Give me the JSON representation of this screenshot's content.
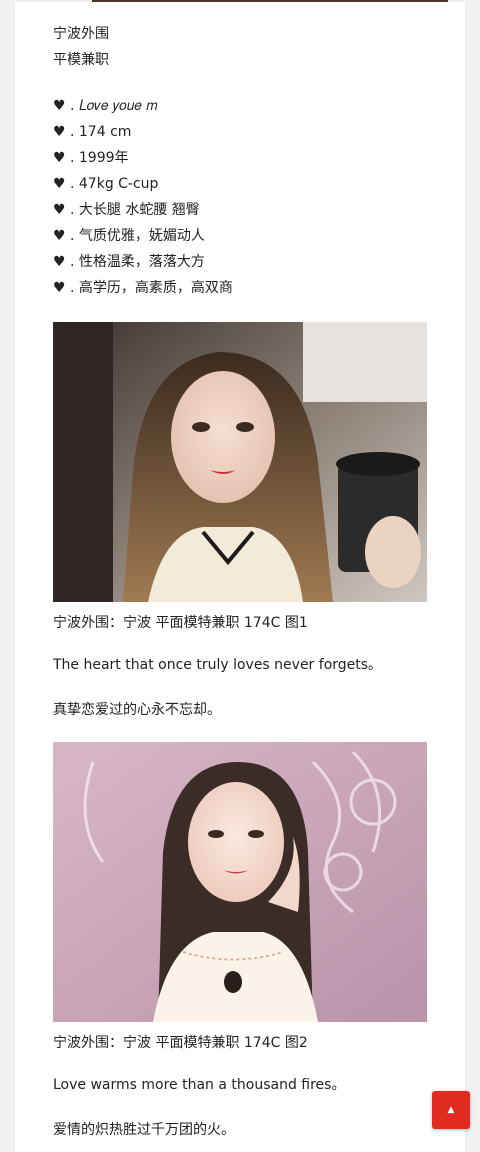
{
  "post": {
    "intro": [
      "宁波外围",
      "平模兼职"
    ],
    "attributes": [
      "♥ . 𝐿𝑜𝑣𝑒 𝑦𝑜𝑢𝑒 𝑚",
      "♥ . 174 cm",
      "♥ . 1999年",
      "♥ . 47kg C-cup",
      "♥ . 大长腿 水蛇腰 翘臀",
      "♥ . 气质优雅，妩媚动人",
      "♥ . 性格温柔，落落大方",
      "♥ . 高学历，高素质，高双商"
    ],
    "sections": [
      {
        "caption": "宁波外围：宁波 平面模特兼职 174C 图1",
        "quote_en": "The heart that once truly loves never forgets。",
        "quote_zh": "真挚恋爱过的心永不忘却。"
      },
      {
        "caption": "宁波外围：宁波 平面模特兼职 174C 图2",
        "quote_en": "Love warms more than a thousand fires。",
        "quote_zh": "爱情的炽热胜过千万团的火。"
      }
    ]
  },
  "scroll_top": {
    "icon": "chevron-up-icon",
    "glyph": "▲"
  },
  "colors": {
    "accent": "#e02b20",
    "page_bg": "#f1f1f1",
    "card_bg": "#ffffff"
  }
}
